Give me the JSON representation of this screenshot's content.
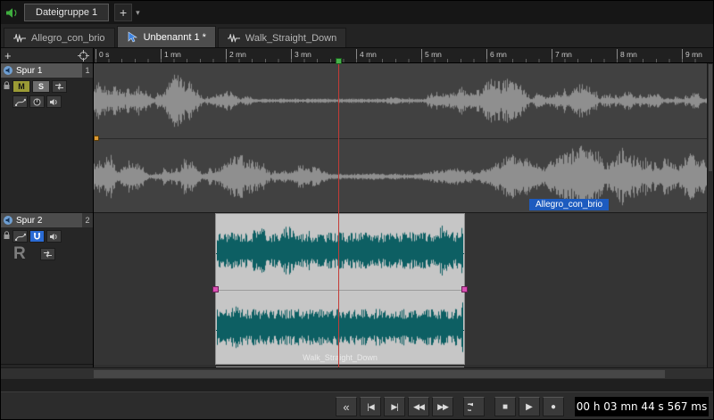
{
  "colors": {
    "cursor_red": "#c43b36",
    "marker_green": "#46b24a",
    "selection_blue": "#1d5bbf",
    "mute_yellow": "#9b9b35",
    "snap_blue": "#2a6bd4",
    "clip_teal": "#0d5f63",
    "clip_background": "#c6c6c6",
    "waveform_gray": "#8f8f8f",
    "handle_magenta": "#d94fb3",
    "handle_orange": "#dd9a33"
  },
  "filegroup_bar": {
    "tab_label": "Dateigruppe 1",
    "add_button_label": "+",
    "dropdown_glyph": "▾"
  },
  "doc_tabs": [
    {
      "label": "Allegro_con_brio"
    },
    {
      "label": "Unbenannt 1 *"
    },
    {
      "label": "Walk_Straight_Down"
    }
  ],
  "track_panel": {
    "add_track_label": "+",
    "tracks": [
      {
        "name": "Spur 1",
        "number": "1",
        "mute_label": "M",
        "solo_label": "S"
      },
      {
        "name": "Spur 2",
        "number": "2",
        "record_label": "R"
      }
    ]
  },
  "ruler": {
    "ticks": [
      "0 s",
      "1 mn",
      "2 mn",
      "3 mn",
      "4 mn",
      "5 mn",
      "6 mn",
      "7 mn",
      "8 mn",
      "9 mn"
    ]
  },
  "clips": {
    "track1_label": "Allegro_con_brio",
    "track2_label": "Walk_Straight_Down"
  },
  "transport": {
    "buttons": [
      {
        "name": "go-to-start",
        "glyph": "«"
      },
      {
        "name": "previous-marker",
        "glyph": "|◀"
      },
      {
        "name": "next-marker",
        "glyph": "▶|"
      },
      {
        "name": "rewind",
        "glyph": "◀◀"
      },
      {
        "name": "fast-forward",
        "glyph": "▶▶"
      },
      {
        "name": "loop",
        "glyph": ""
      },
      {
        "name": "stop",
        "glyph": "■"
      },
      {
        "name": "play",
        "glyph": "▶"
      },
      {
        "name": "record",
        "glyph": "●"
      }
    ],
    "time_display": "00 h 03 mn 44 s 567 ms"
  }
}
